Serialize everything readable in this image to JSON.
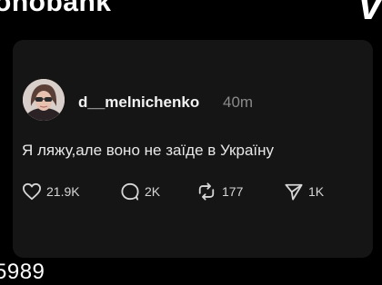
{
  "header": {
    "bank_name": "onobank",
    "card_logo": "VI"
  },
  "post": {
    "username": "d__melnichenko",
    "time": "40m",
    "text": "Я ляжу,але воно не заїде в Україну",
    "avatar_icon": "profile-photo",
    "stats": {
      "likes": "21.9K",
      "comments": "2K",
      "reposts": "177",
      "shares": "1K"
    }
  },
  "footer": {
    "number": "5989"
  },
  "colors": {
    "background": "#000000",
    "post_background": "#151515",
    "text": "#e8e8e8",
    "muted": "#8a8a8a"
  }
}
